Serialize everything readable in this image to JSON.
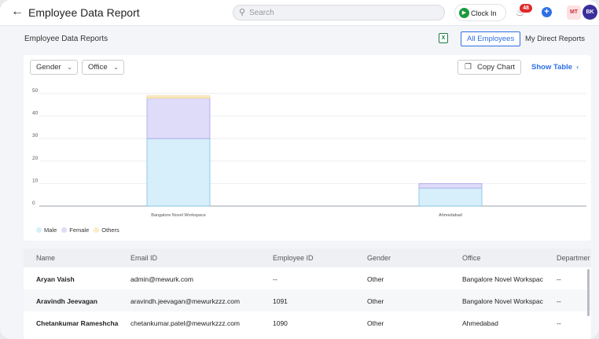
{
  "header": {
    "back_icon": "arrow-left-icon",
    "title": "Employee Data Report",
    "search_placeholder": "Search",
    "clock_in_label": "Clock In",
    "notification_count": "48",
    "avatar_1": "MT",
    "avatar_2": "BK"
  },
  "section": {
    "title": "Employee Data Reports",
    "tabs": [
      {
        "label": "All Employees",
        "active": true
      },
      {
        "label": "My Direct Reports",
        "active": false
      }
    ]
  },
  "toolbar": {
    "filter_gender": "Gender",
    "filter_office": "Office",
    "copy_chart_label": "Copy Chart",
    "show_table_label": "Show Table"
  },
  "chart_data": {
    "type": "bar",
    "stacked": true,
    "categories": [
      "Bangalore Novel Workspace",
      "Ahmedabad"
    ],
    "series": [
      {
        "name": "Male",
        "values": [
          30,
          8
        ],
        "color": "#d6effa"
      },
      {
        "name": "Female",
        "values": [
          18,
          2
        ],
        "color": "#dedcf8"
      },
      {
        "name": "Others",
        "values": [
          1,
          0
        ],
        "color": "#fcecc6"
      }
    ],
    "yticks": [
      "0",
      "10",
      "20",
      "30",
      "40",
      "50"
    ],
    "ylim": [
      0,
      50
    ],
    "grid": true,
    "legend_position": "bottom-left"
  },
  "table": {
    "columns": [
      "Name",
      "Email ID",
      "Employee ID",
      "Gender",
      "Office",
      "Departmer"
    ],
    "rows": [
      {
        "name": "Aryan Vaish",
        "email": "admin@mewurk.com",
        "employee_id": "--",
        "gender": "Other",
        "office": "Bangalore Novel Workspac",
        "department": "--"
      },
      {
        "name": "Aravindh Jeevagan",
        "email": "aravindh.jeevagan@mewurkzzz.com",
        "employee_id": "1091",
        "gender": "Other",
        "office": "Bangalore Novel Workspac",
        "department": "--"
      },
      {
        "name": "Chetankumar Rameshcha",
        "email": "chetankumar.patel@mewurkzzz.com",
        "employee_id": "1090",
        "gender": "Other",
        "office": "Ahmedabad",
        "department": "--"
      }
    ]
  }
}
